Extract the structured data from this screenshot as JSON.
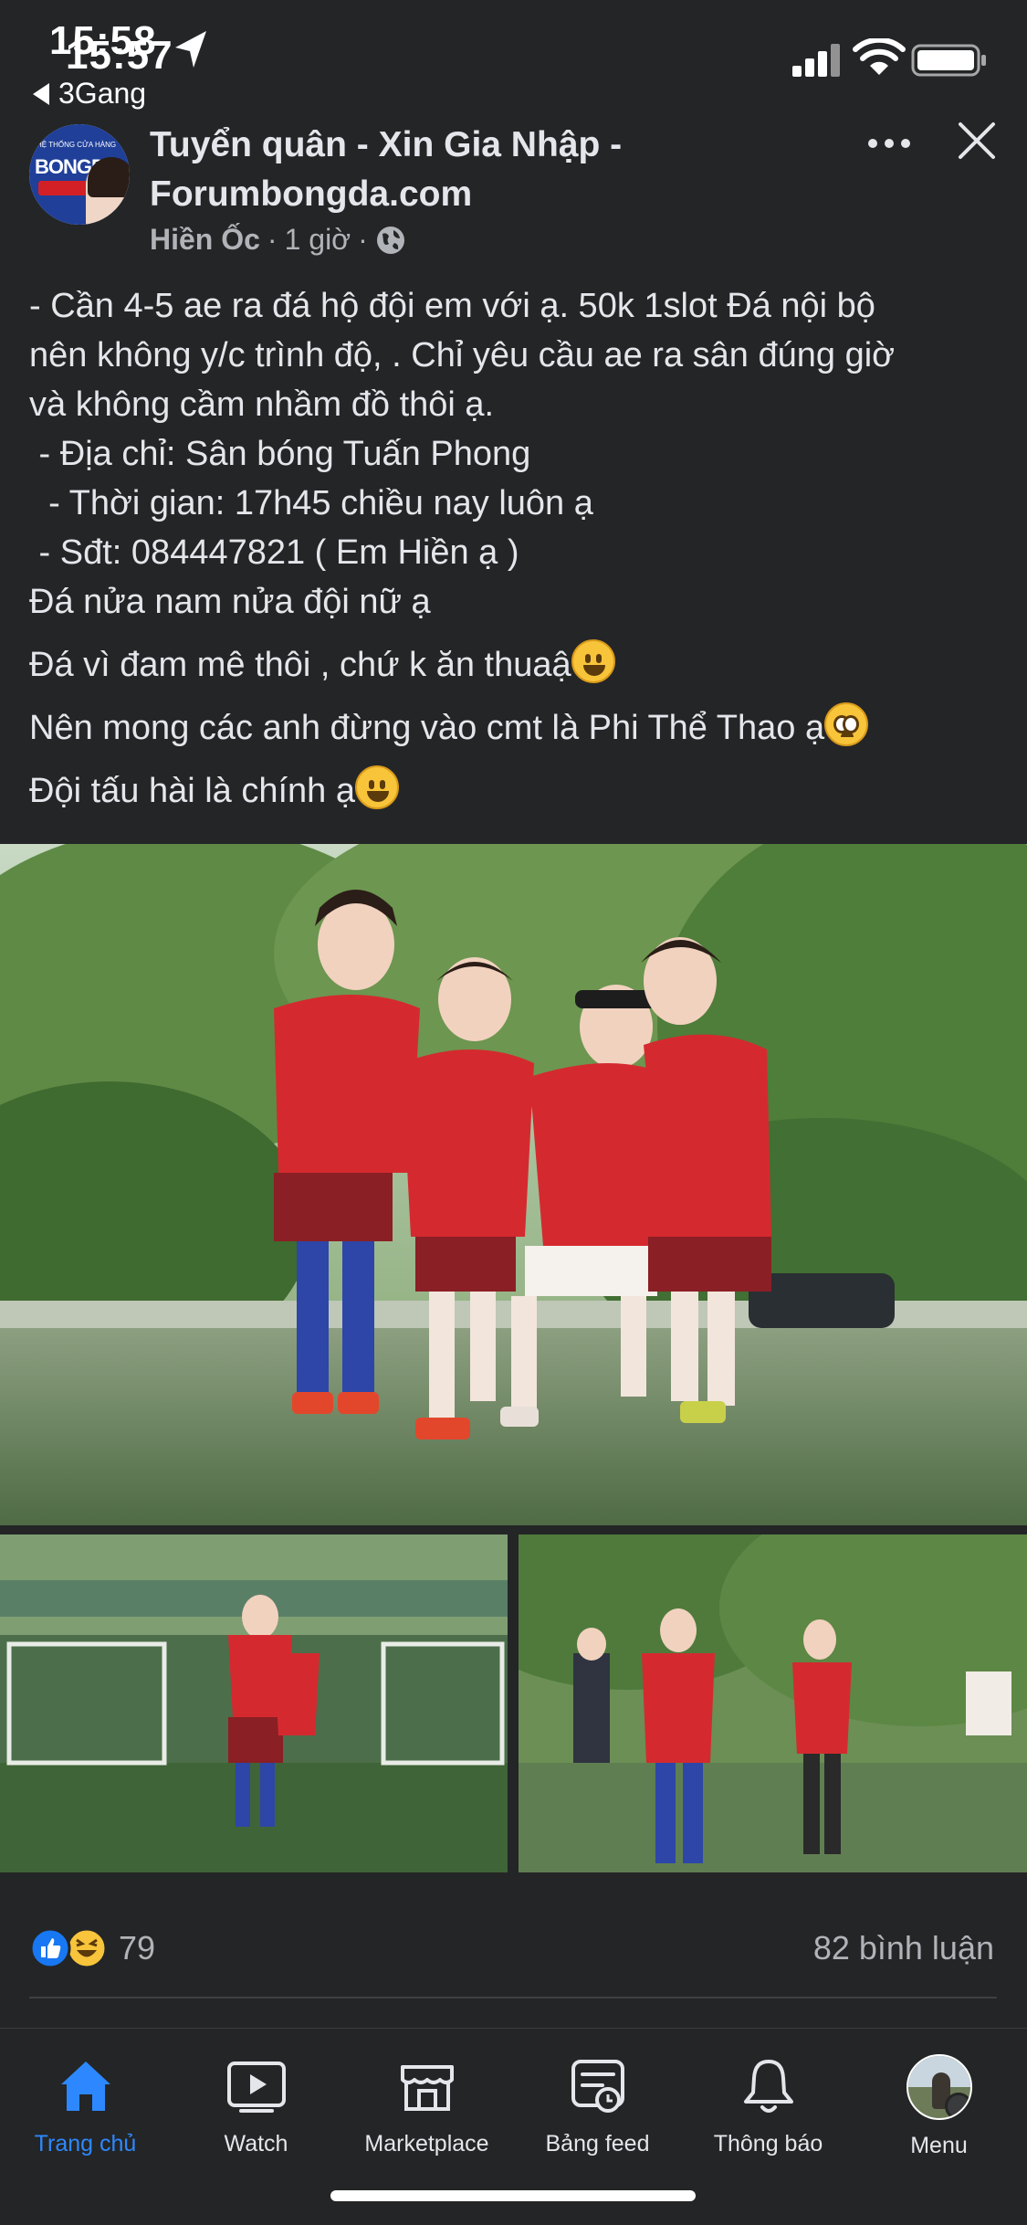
{
  "status_bar": {
    "time_back": "15:58",
    "time_front": "15:57",
    "back_app_label": "3Gang"
  },
  "post": {
    "page_name": "Tuyển quân - Xin Gia Nhập - Forumbongda.com",
    "avatar_logo_text": "BONGDA",
    "avatar_logo_subtext": "HỆ THỐNG CỬA HÀNG",
    "author": "Hiền Ốc",
    "time": "1 giờ",
    "separator": "·",
    "body_lines": [
      "- Cần 4-5 ae ra đá hộ đội em với ạ. 50k 1slot Đá nội bộ",
      "nên không y/c trình độ, . Chỉ yêu cầu ae ra sân đúng giờ",
      "và không cầm nhầm đồ thôi ạ.",
      " - Địa chỉ: Sân bóng Tuấn Phong",
      "  - Thời gian: 17h45 chiều nay luôn ạ",
      " - Sđt: 084447821 ( Em Hiền ạ )",
      "Đá nửa nam nửa đội nữ ạ"
    ],
    "line_passion": "Đá vì đam mê thôi , chứ k ăn thuaậ",
    "line_ask": "Nên mong các anh đừng vào cmt là Phi Thể Thao ạ",
    "line_fun": "Đội tấu hài là chính ạ",
    "emojis": [
      "grinning-face",
      "pleading-face",
      "grinning-face"
    ]
  },
  "reactions": {
    "types": [
      "like",
      "haha"
    ],
    "count": "79",
    "comments": "82 bình luận"
  },
  "tab_bar": {
    "tabs": [
      {
        "label": "Trang chủ",
        "icon": "home-icon",
        "active": true
      },
      {
        "label": "Watch",
        "icon": "watch-icon",
        "active": false
      },
      {
        "label": "Marketplace",
        "icon": "marketplace-icon",
        "active": false
      },
      {
        "label": "Bảng feed",
        "icon": "feed-icon",
        "active": false
      },
      {
        "label": "Thông báo",
        "icon": "bell-icon",
        "active": false
      },
      {
        "label": "Menu",
        "icon": "profile-avatar",
        "active": false
      }
    ]
  },
  "colors": {
    "background": "#242526",
    "text_primary": "#e4e6eb",
    "text_secondary": "#b0b3b8",
    "accent_blue": "#2d88ff",
    "jersey_red": "#d42a2f"
  }
}
